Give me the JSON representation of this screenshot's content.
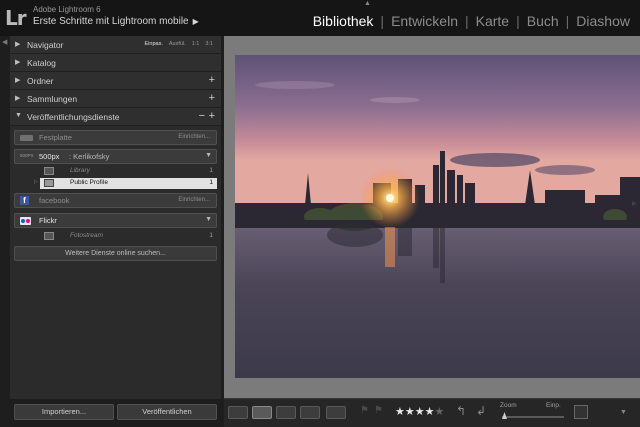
{
  "app": {
    "logo": "Lr",
    "name": "Adobe Lightroom 6",
    "subtitle": "Erste Schritte mit Lightroom mobile"
  },
  "modules": [
    "Bibliothek",
    "Entwickeln",
    "Karte",
    "Buch",
    "Diashow"
  ],
  "active_module": "Bibliothek",
  "panels": {
    "navigator": {
      "label": "Navigator",
      "modes": [
        "Einpas.",
        "Ausfül.",
        "1:1",
        "3:1"
      ]
    },
    "katalog": {
      "label": "Katalog"
    },
    "ordner": {
      "label": "Ordner",
      "plus": "+"
    },
    "sammlungen": {
      "label": "Sammlungen",
      "plus": "+"
    },
    "publish": {
      "label": "Veröffentlichungsdienste",
      "minus": "−",
      "plus": "+"
    }
  },
  "services": {
    "festplatte": {
      "name": "Festplatte",
      "action": "Einrichten..."
    },
    "fivehundred": {
      "logo": "500PX",
      "name": "500px",
      "user": ": Kerlikofsky"
    },
    "library": {
      "name": "Library",
      "count": "1"
    },
    "public_profile": {
      "name": "Public Profile",
      "count": "1"
    },
    "facebook": {
      "name": "facebook",
      "icon_letter": "f",
      "action": "Einrichten..."
    },
    "flickr": {
      "name": "Flickr"
    },
    "fotostream": {
      "name": "Fotostream",
      "count": "1"
    },
    "more": "Weitere Dienste online suchen..."
  },
  "buttons": {
    "import": "Importieren...",
    "publish": "Veröffentlichen"
  },
  "toolbar": {
    "rating": "★★★★",
    "rating_empty": "★",
    "rating_value": 4,
    "zoom_label": "Zoom",
    "zoom_value": "Einp."
  },
  "icons": [
    "grid-view-icon",
    "loupe-view-icon",
    "compare-view-icon",
    "survey-view-icon",
    "people-view-icon",
    "flag-icon",
    "reject-flag-icon",
    "rotate-left-icon",
    "rotate-right-icon",
    "crop-icon"
  ],
  "colors": {
    "accent_active_module": "#ffffff",
    "panel_bg": "#2b2b2b",
    "selected_row": "#e2e2e2"
  }
}
